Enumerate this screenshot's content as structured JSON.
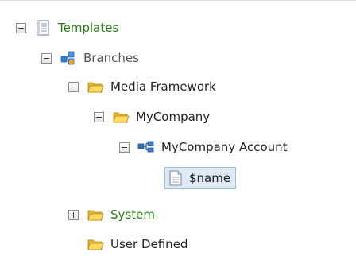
{
  "tree": {
    "nodes": [
      {
        "label": "Templates",
        "icon": "template-icon",
        "expanded": true
      },
      {
        "label": "Branches",
        "icon": "branches-icon",
        "expanded": true
      },
      {
        "label": "Media Framework",
        "icon": "folder-icon",
        "expanded": true
      },
      {
        "label": "MyCompany",
        "icon": "folder-icon",
        "expanded": true
      },
      {
        "label": "MyCompany Account",
        "icon": "branch-template-icon",
        "expanded": true
      },
      {
        "label": "$name",
        "icon": "document-icon",
        "selected": true
      },
      {
        "label": "System",
        "icon": "folder-icon",
        "expanded": false
      },
      {
        "label": "User Defined",
        "icon": "folder-icon"
      }
    ]
  },
  "colors": {
    "green_text": "#2a7a1a",
    "gray_text": "#555555",
    "selection_bg": "#dfe9f5",
    "selection_border": "#9fbddc"
  }
}
